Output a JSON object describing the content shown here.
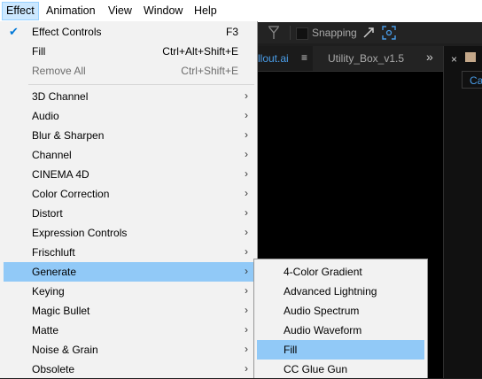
{
  "menubar": {
    "items": [
      {
        "label": "Effect",
        "active": true
      },
      {
        "label": "Animation"
      },
      {
        "label": "View"
      },
      {
        "label": "Window"
      },
      {
        "label": "Help"
      }
    ]
  },
  "toolbar": {
    "snapping_label": "Snapping"
  },
  "tabs": {
    "active_tab": "llout.ai",
    "tab2": "Utility_Box_v1.5",
    "more_icon": "double-chevron-right-icon",
    "menu_icon": "hamburger-icon"
  },
  "right_panel": {
    "close_label": "×",
    "button_label": "Cal"
  },
  "effect_menu": {
    "top_items": [
      {
        "label": "Effect Controls",
        "shortcut": "F3",
        "checked": true
      },
      {
        "label": "Fill",
        "shortcut": "Ctrl+Alt+Shift+E"
      },
      {
        "label": "Remove All",
        "shortcut": "Ctrl+Shift+E",
        "disabled": true
      }
    ],
    "categories": [
      {
        "label": "3D Channel"
      },
      {
        "label": "Audio"
      },
      {
        "label": "Blur & Sharpen"
      },
      {
        "label": "Channel"
      },
      {
        "label": "CINEMA 4D"
      },
      {
        "label": "Color Correction"
      },
      {
        "label": "Distort"
      },
      {
        "label": "Expression Controls"
      },
      {
        "label": "Frischluft"
      },
      {
        "label": "Generate",
        "highlighted": true
      },
      {
        "label": "Keying"
      },
      {
        "label": "Magic Bullet"
      },
      {
        "label": "Matte"
      },
      {
        "label": "Noise & Grain"
      },
      {
        "label": "Obsolete"
      }
    ]
  },
  "generate_submenu": {
    "items": [
      {
        "label": "4-Color Gradient"
      },
      {
        "label": "Advanced Lightning"
      },
      {
        "label": "Audio Spectrum"
      },
      {
        "label": "Audio Waveform"
      },
      {
        "label": "Fill",
        "highlighted": true
      },
      {
        "label": "CC Glue Gun"
      }
    ]
  },
  "colors": {
    "highlight": "#91c9f7",
    "menu_bg": "#f2f2f2",
    "accent_blue": "#4a9de8"
  }
}
